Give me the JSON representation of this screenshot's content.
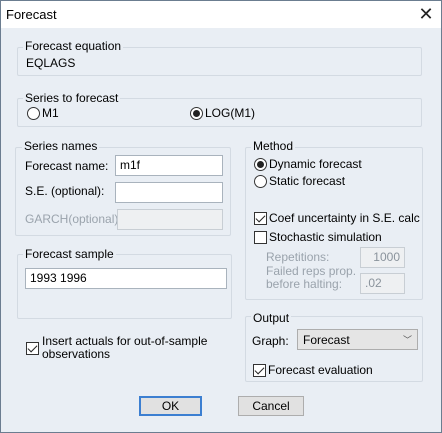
{
  "window": {
    "title": "Forecast",
    "close_icon": "close-icon"
  },
  "equation": {
    "label": "Forecast equation",
    "value": "EQLAGS"
  },
  "series_to_forecast": {
    "label": "Series to forecast",
    "options": [
      {
        "label": "M1",
        "selected": false
      },
      {
        "label": "LOG(M1)",
        "selected": true
      }
    ]
  },
  "series_names": {
    "label": "Series names",
    "forecast_name_label": "Forecast name:",
    "forecast_name_value": "m1f",
    "se_label": "S.E. (optional):",
    "se_value": "",
    "garch_label": "GARCH(optional):",
    "garch_value": ""
  },
  "sample": {
    "label": "Forecast sample",
    "value": "1993 1996"
  },
  "method": {
    "label": "Method",
    "dynamic": "Dynamic forecast",
    "static": "Static forecast",
    "coef": "Coef uncertainty in S.E. calc",
    "stochastic": "Stochastic simulation",
    "repetitions_label": "Repetitions:",
    "repetitions_value": "1000",
    "failed_label_1": "Failed reps prop.",
    "failed_label_2": "before halting:",
    "failed_value": ".02"
  },
  "output": {
    "label": "Output",
    "graph_label": "Graph:",
    "graph_value": "Forecast",
    "evaluation": "Forecast evaluation"
  },
  "insert_actuals": {
    "line1": "Insert actuals for out-of-sample",
    "line2": "observations"
  },
  "buttons": {
    "ok": "OK",
    "cancel": "Cancel"
  }
}
